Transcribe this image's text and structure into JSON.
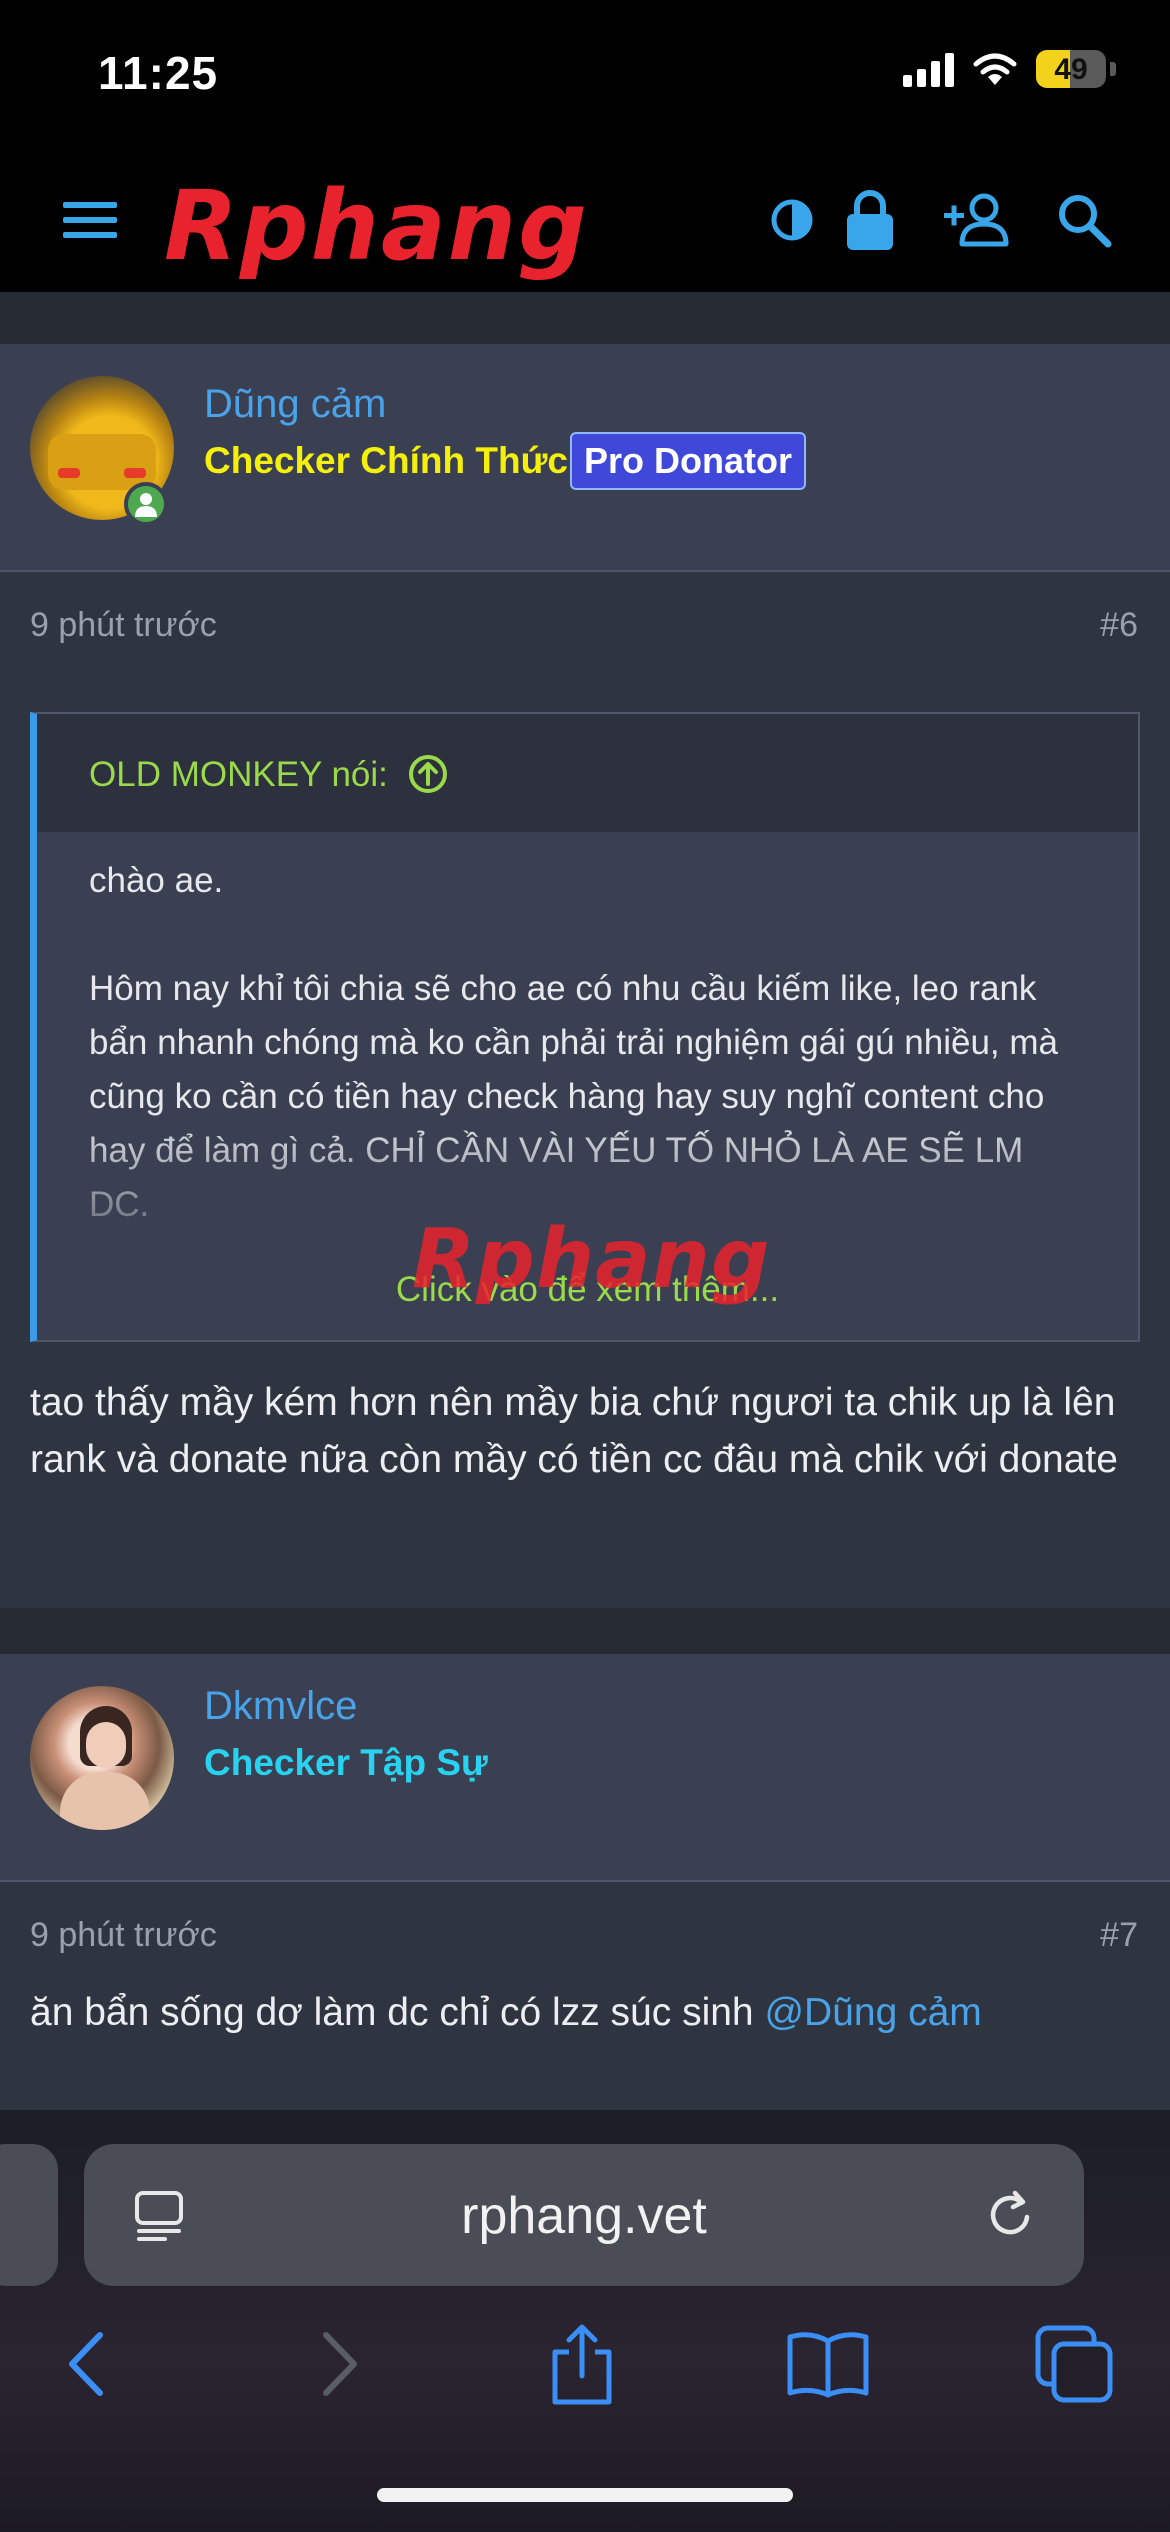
{
  "status_bar": {
    "time": "11:25",
    "battery": "49",
    "battery_level": 0.49
  },
  "header": {
    "logo": "Rphang",
    "icons": [
      "menu-icon",
      "contrast-icon",
      "lock-icon",
      "add-user-icon",
      "search-icon"
    ]
  },
  "posts": [
    {
      "username": "Dũng cảm",
      "user_title": "Checker Chính Thức",
      "badge": "Pro Donator",
      "time": "9 phút trước",
      "number": "#6",
      "quote": {
        "author": "OLD MONKEY nói:",
        "line1": "chào ae.",
        "line2": "Hôm nay khỉ tôi chia sẽ cho ae có nhu cầu kiếm like, leo rank bẩn nhanh chóng mà ko cần phải trải nghiệm gái gú nhiều, mà cũng ko cần có tiền hay check hàng hay suy nghĩ content cho hay để làm gì cả. CHỈ CẦN VÀI YẾU TỐ NHỎ LÀ AE SẼ LM DC.",
        "expand": "Click vào để xem thêm..."
      },
      "body": "tao thấy mầy kém hơn nên mầy bia chứ ngươi ta chik up là lên rank và donate nữa còn mầy có tiền cc đâu mà chik với donate"
    },
    {
      "username": "Dkmvlce",
      "user_title": "Checker Tập Sự",
      "time": "9 phút trước",
      "number": "#7",
      "body": "ăn bẩn sống dơ làm dc chỉ có lzz súc sinh ",
      "mention": "@Dũng cảm"
    }
  ],
  "safari": {
    "url": "rphang.vet",
    "toolbar": [
      "back-icon",
      "forward-icon",
      "share-icon",
      "bookmarks-icon",
      "tabs-icon"
    ]
  },
  "colors": {
    "accent_blue": "#4aa3e8",
    "title_yellow": "#f5f00b",
    "title_cyan": "#27d3f0",
    "quote_green": "#9ad94a",
    "badge_blue": "#3f48d8"
  }
}
